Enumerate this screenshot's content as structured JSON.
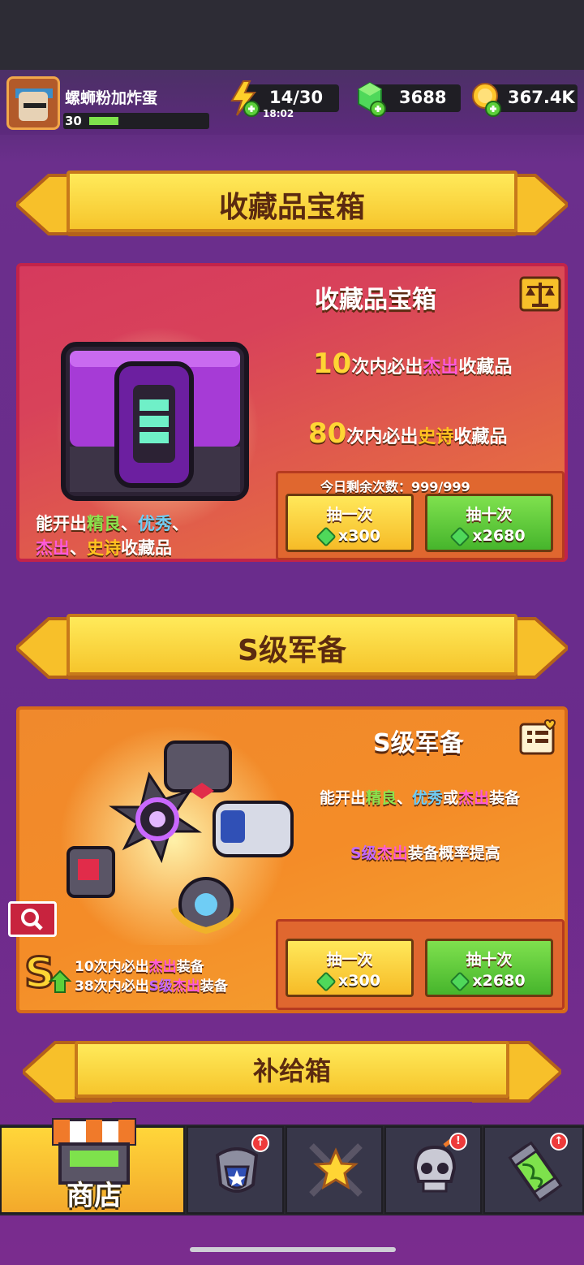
{
  "player": {
    "name": "螺蛳粉加炸蛋",
    "level": "30"
  },
  "resources": {
    "energy": "14/30",
    "energy_timer": "18:02",
    "gems": "3688",
    "coins": "367.4K"
  },
  "section1": {
    "banner": "收藏品宝箱",
    "card_title": "收藏品宝箱",
    "line1": {
      "num": "10",
      "pre": "次内必出",
      "hl": "杰出",
      "post": "收藏品"
    },
    "line2": {
      "num": "80",
      "pre": "次内必出",
      "hl": "史诗",
      "post": "收藏品"
    },
    "desc": {
      "a": "能开出",
      "b": "精良",
      "c": "、",
      "d": "优秀",
      "e": "、",
      "f": "杰出",
      "g": "、",
      "h": "史诗",
      "i": "收藏品"
    },
    "remaining": "今日剩余次数：999/999",
    "btn_single": {
      "label": "抽一次",
      "cost": "x300"
    },
    "btn_ten": {
      "label": "抽十次",
      "cost": "x2680"
    }
  },
  "section2": {
    "banner": "S级军备",
    "card_title": "S级军备",
    "line1": {
      "a": "能开出",
      "b": "精良",
      "c": "、",
      "d": "优秀",
      "e": "或",
      "f": "杰出",
      "g": "装备"
    },
    "line2": {
      "a": "S级",
      "b": "杰出",
      "c": "装备概率提高"
    },
    "pity1": {
      "a": "10次内必出",
      "b": "杰出",
      "c": "装备"
    },
    "pity2": {
      "a": "38次内必出",
      "b": "S级",
      "c": "杰出",
      "d": "装备"
    },
    "btn_single": {
      "label": "抽一次",
      "cost": "x300"
    },
    "btn_ten": {
      "label": "抽十次",
      "cost": "x2680"
    }
  },
  "section3": {
    "banner": "补给箱"
  },
  "nav": {
    "shop_label": "商店"
  },
  "colors": {
    "accent_yellow": "#ffd534",
    "gem_green": "#4fd85a",
    "card1": "#d8425a",
    "card2": "#f48c28"
  }
}
